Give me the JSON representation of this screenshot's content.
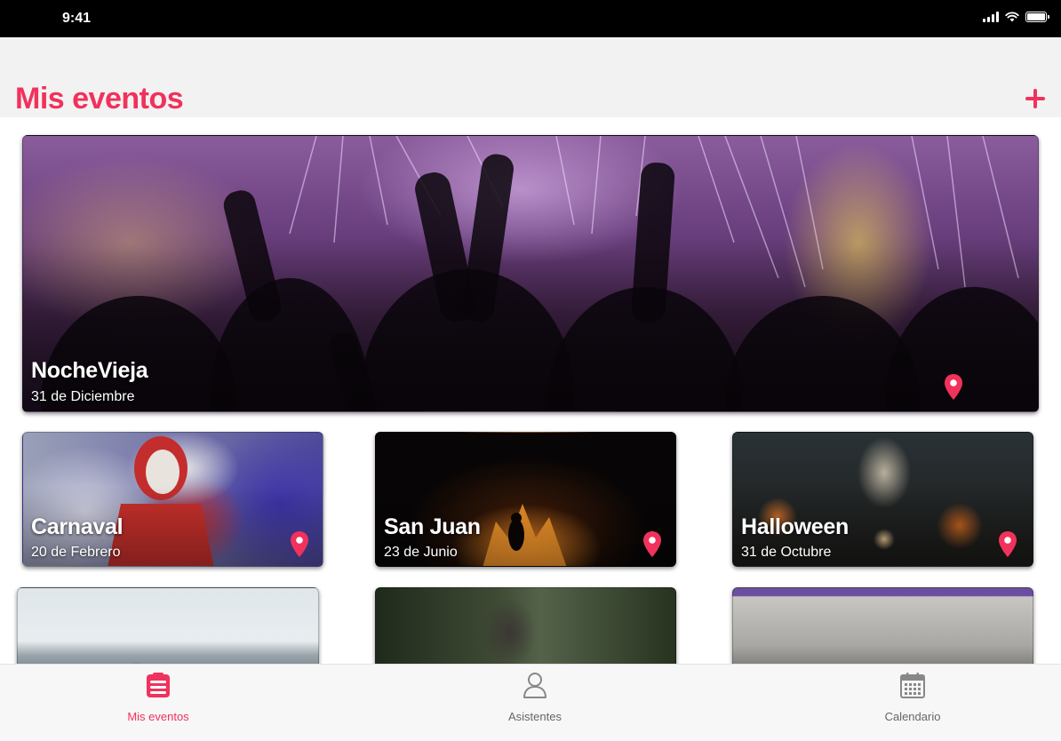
{
  "status_bar": {
    "time": "9:41"
  },
  "header": {
    "title": "Mis eventos",
    "add_icon": "plus-icon"
  },
  "colors": {
    "accent": "#f0325c",
    "tab_inactive": "#777777"
  },
  "events": [
    {
      "title": "NocheVieja",
      "date": "31 de Diciembre",
      "icon": "location-pin-icon"
    },
    {
      "title": "Carnaval",
      "date": "20 de Febrero",
      "icon": "location-pin-icon"
    },
    {
      "title": "San Juan",
      "date": "23 de Junio",
      "icon": "location-pin-icon"
    },
    {
      "title": "Halloween",
      "date": "31 de Octubre",
      "icon": "location-pin-icon"
    }
  ],
  "tabs": [
    {
      "label": "Mis eventos",
      "icon": "list-icon",
      "active": true
    },
    {
      "label": "Asistentes",
      "icon": "person-icon",
      "active": false
    },
    {
      "label": "Calendario",
      "icon": "calendar-icon",
      "active": false
    }
  ]
}
